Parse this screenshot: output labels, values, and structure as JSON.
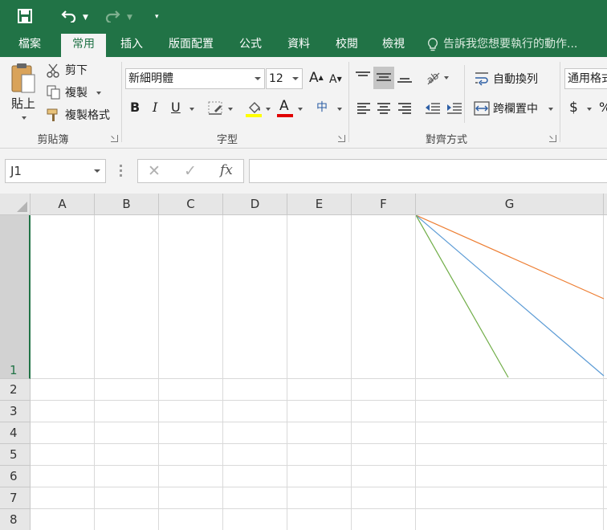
{
  "quick_access": {
    "save_icon": "save-icon",
    "undo_icon": "undo-icon",
    "redo_icon": "redo-icon",
    "customize_icon": "customize-qat-icon"
  },
  "tabs": [
    {
      "label": "檔案"
    },
    {
      "label": "常用"
    },
    {
      "label": "插入"
    },
    {
      "label": "版面配置"
    },
    {
      "label": "公式"
    },
    {
      "label": "資料"
    },
    {
      "label": "校閱"
    },
    {
      "label": "檢視"
    }
  ],
  "tell_me": "告訴我您想要執行的動作...",
  "clipboard": {
    "paste": "貼上",
    "cut": "剪下",
    "copy": "複製",
    "format_painter": "複製格式",
    "group_label": "剪貼簿"
  },
  "font": {
    "font_name": "新細明體",
    "font_size": "12",
    "bold": "B",
    "italic": "I",
    "underline": "U",
    "font_color_glyph": "A",
    "grow": "A",
    "shrink": "A",
    "phonetic": "中",
    "group_label": "字型",
    "highlight_color": "#ffff00",
    "text_color": "#e00000"
  },
  "alignment": {
    "wrap_text": "自動換列",
    "merge_center": "跨欄置中",
    "group_label": "對齊方式"
  },
  "number": {
    "format": "通用格式",
    "currency": "$",
    "percent": "%"
  },
  "formula_bar": {
    "name_box": "J1",
    "cancel_icon": "✕",
    "enter_icon": "✓",
    "fx": "fx",
    "formula": ""
  },
  "grid": {
    "columns": [
      "A",
      "B",
      "C",
      "D",
      "E",
      "F",
      "G"
    ],
    "rows": [
      "1",
      "2",
      "3",
      "4",
      "5",
      "6",
      "7",
      "8"
    ],
    "selected_row": "1"
  },
  "chart_lines": {
    "colors": [
      "#ed7d31",
      "#5b9bd5",
      "#70ad47"
    ]
  }
}
